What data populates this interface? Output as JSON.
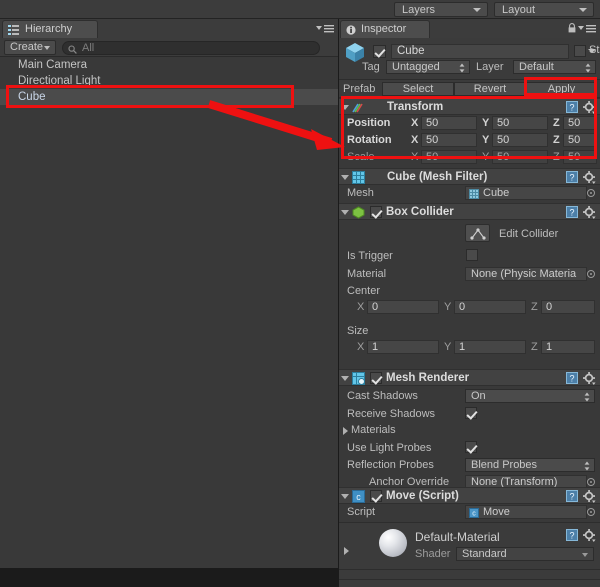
{
  "toolbar": {
    "layers_label": "Layers",
    "layout_label": "Layout"
  },
  "hierarchy": {
    "tab_label": "Hierarchy",
    "tab_icon": "hierarchy-icon",
    "create_label": "Create",
    "search_value": "All",
    "search_icon": "search-icon",
    "menu_icon": "panel-menu-icon",
    "items": [
      {
        "label": "Main Camera",
        "selected": false
      },
      {
        "label": "Directional Light",
        "selected": false
      },
      {
        "label": "Cube",
        "selected": true
      }
    ]
  },
  "inspector": {
    "tab_label": "Inspector",
    "tab_icon": "info-icon",
    "lock_icon": "lock-icon",
    "menu_icon": "panel-menu-icon",
    "object": {
      "name": "Cube",
      "active": true,
      "static_label": "Static",
      "static_checked": false,
      "tag_label": "Tag",
      "tag_value": "Untagged",
      "layer_label": "Layer",
      "layer_value": "Default"
    },
    "prefab": {
      "label": "Prefab",
      "select_label": "Select",
      "revert_label": "Revert",
      "apply_label": "Apply"
    },
    "components": [
      {
        "title": "Transform",
        "icon": "transform-icon",
        "rows": [
          {
            "label": "Position",
            "x": "50",
            "y": "50",
            "z": "50"
          },
          {
            "label": "Rotation",
            "x": "50",
            "y": "50",
            "z": "50"
          },
          {
            "label": "Scale",
            "x": "50",
            "y": "50",
            "z": "50"
          }
        ],
        "axis_x": "X",
        "axis_y": "Y",
        "axis_z": "Z"
      },
      {
        "title": "Cube (Mesh Filter)",
        "icon": "mesh-filter-icon",
        "mesh_label": "Mesh",
        "mesh_value": "Cube"
      },
      {
        "title": "Box Collider",
        "icon": "box-collider-icon",
        "enabled": true,
        "edit_collider_label": "Edit Collider",
        "edit_collider_icon": "collider-edit-icon",
        "is_trigger_label": "Is Trigger",
        "is_trigger_checked": false,
        "material_label": "Material",
        "material_value": "None (Physic Materia",
        "center_label": "Center",
        "center": {
          "x": "0",
          "y": "0",
          "z": "0"
        },
        "size_label": "Size",
        "size": {
          "x": "1",
          "y": "1",
          "z": "1"
        }
      },
      {
        "title": "Mesh Renderer",
        "icon": "mesh-renderer-icon",
        "enabled": true,
        "cast_shadows_label": "Cast Shadows",
        "cast_shadows_value": "On",
        "receive_shadows_label": "Receive Shadows",
        "receive_shadows_checked": true,
        "materials_label": "Materials",
        "use_light_probes_label": "Use Light Probes",
        "use_light_probes_checked": true,
        "reflection_probes_label": "Reflection Probes",
        "reflection_probes_value": "Blend Probes",
        "anchor_override_label": "Anchor Override",
        "anchor_override_value": "None (Transform)"
      },
      {
        "title": "Move (Script)",
        "icon": "script-icon",
        "enabled": true,
        "script_label": "Script",
        "script_value": "Move"
      }
    ],
    "material_footer": {
      "name": "Default-Material",
      "shader_label": "Shader",
      "shader_value": "Standard",
      "preview_icon": "material-sphere-icon"
    }
  },
  "annotations": {
    "color": "#ee1111",
    "boxes": [
      {
        "name": "highlight-cube-hierarchy"
      },
      {
        "name": "highlight-apply-button"
      },
      {
        "name": "highlight-transform-section"
      }
    ],
    "arrow": {
      "name": "pointer-arrow"
    }
  }
}
